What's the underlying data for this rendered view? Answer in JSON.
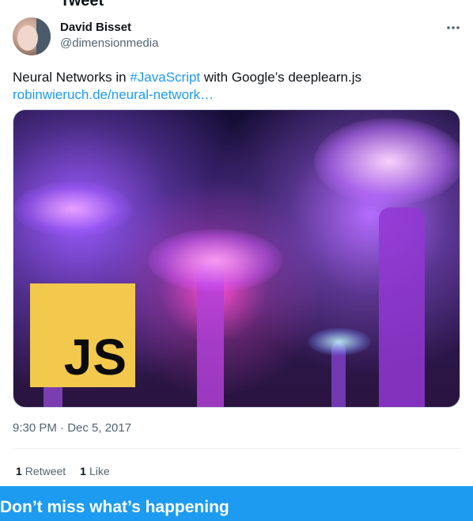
{
  "header": {
    "partial_title": "Tweet"
  },
  "tweet": {
    "author_name": "David Bisset",
    "author_handle": "@dimensionmedia",
    "text_before": "Neural Networks in ",
    "hashtag": "#JavaScript",
    "text_after": " with Google’s deeplearn.js",
    "link_text": "robinwieruch.de/neural-network…",
    "media_logo_text": "JS",
    "timestamp": "9:30 PM · Dec 5, 2017",
    "retweet_count": "1",
    "retweet_label": "Retweet",
    "like_count": "1",
    "like_label": "Like"
  },
  "banner": {
    "title": "Don’t miss what’s happening"
  },
  "colors": {
    "accent": "#1d9bf0",
    "secondary_text": "#536471",
    "logo_yellow": "#f2c94c"
  },
  "icons": {
    "more": "more-dots-icon"
  }
}
